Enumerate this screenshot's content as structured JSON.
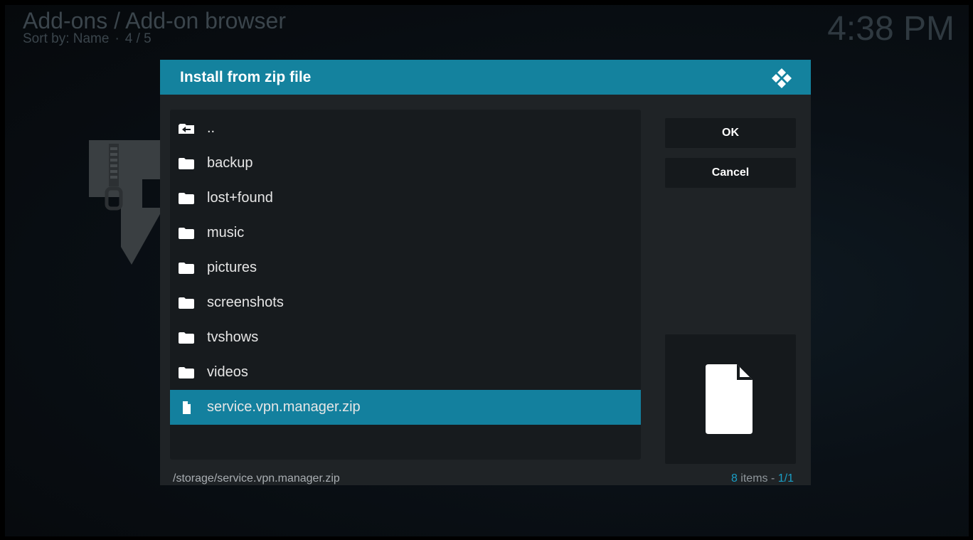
{
  "header": {
    "title": "Add-ons / Add-on browser",
    "sort_label": "Sort by: Name",
    "separator": "·",
    "position": "4 / 5"
  },
  "clock": "4:38 PM",
  "dialog": {
    "title": "Install from zip file",
    "logo_icon": "kodi-logo-icon",
    "accent_color": "#14829e",
    "items": [
      {
        "label": "..",
        "icon": "parent-folder-icon"
      },
      {
        "label": "backup",
        "icon": "folder-icon"
      },
      {
        "label": "lost+found",
        "icon": "folder-icon"
      },
      {
        "label": "music",
        "icon": "folder-icon"
      },
      {
        "label": "pictures",
        "icon": "folder-icon"
      },
      {
        "label": "screenshots",
        "icon": "folder-icon"
      },
      {
        "label": "tvshows",
        "icon": "folder-icon"
      },
      {
        "label": "videos",
        "icon": "folder-icon"
      },
      {
        "label": "service.vpn.manager.zip",
        "icon": "file-icon",
        "selected": true
      }
    ],
    "buttons": {
      "ok": "OK",
      "cancel": "Cancel"
    },
    "preview_icon": "file-icon",
    "path": "/storage/service.vpn.manager.zip",
    "count": {
      "items_number": "8",
      "items_word": " items - ",
      "page": "1/1"
    }
  }
}
